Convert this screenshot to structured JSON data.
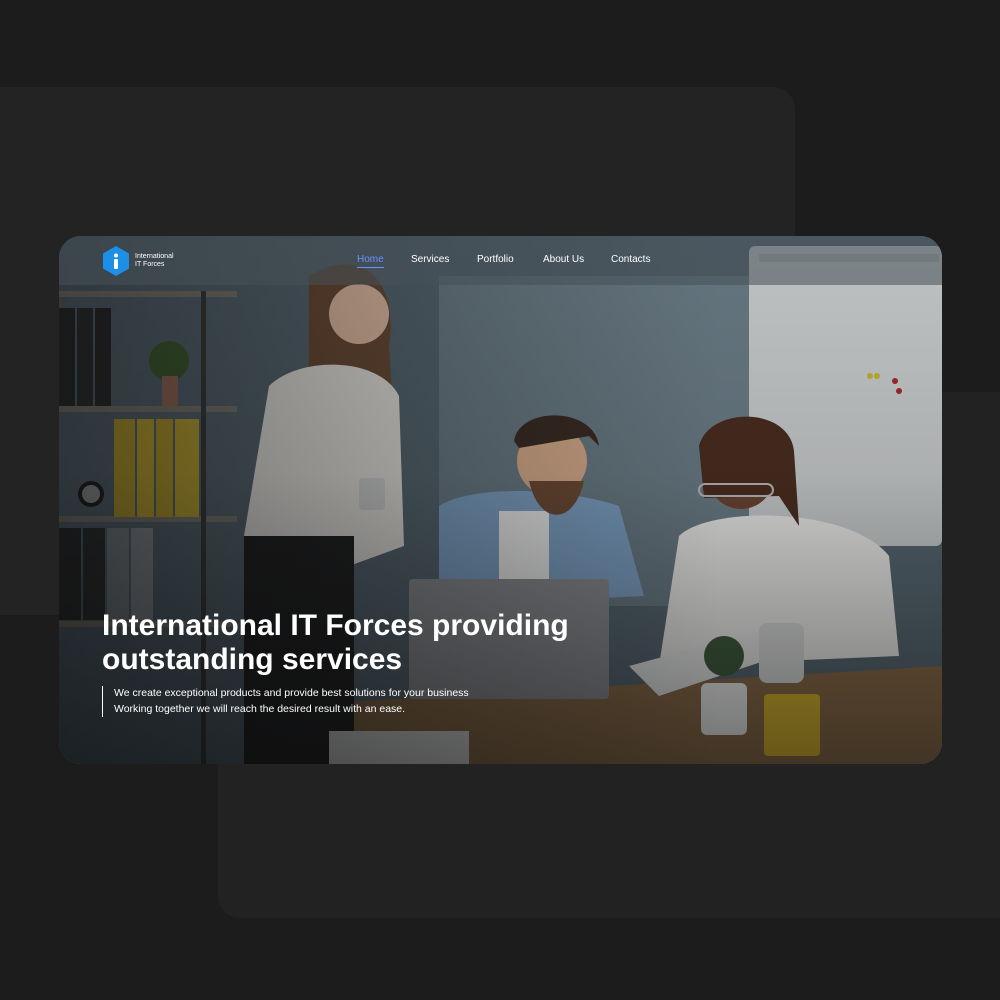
{
  "brand": {
    "name_line1": "International",
    "name_line2": "IT Forces",
    "accent": "#1e8fe6"
  },
  "nav": {
    "home": "Home",
    "services": "Services",
    "portfolio": "Portfolio",
    "about": "About Us",
    "contacts": "Contacts",
    "active_color": "#6e8fff"
  },
  "hero": {
    "headline_line1": "International IT Forces providing",
    "headline_line2": "outstanding services",
    "sub_line1": "We create exceptional products and provide best solutions for your business",
    "sub_line2": "Working together we will reach the desired result with an ease."
  },
  "colors": {
    "page_bg": "#1c1c1c",
    "panel_bg": "#232323"
  }
}
